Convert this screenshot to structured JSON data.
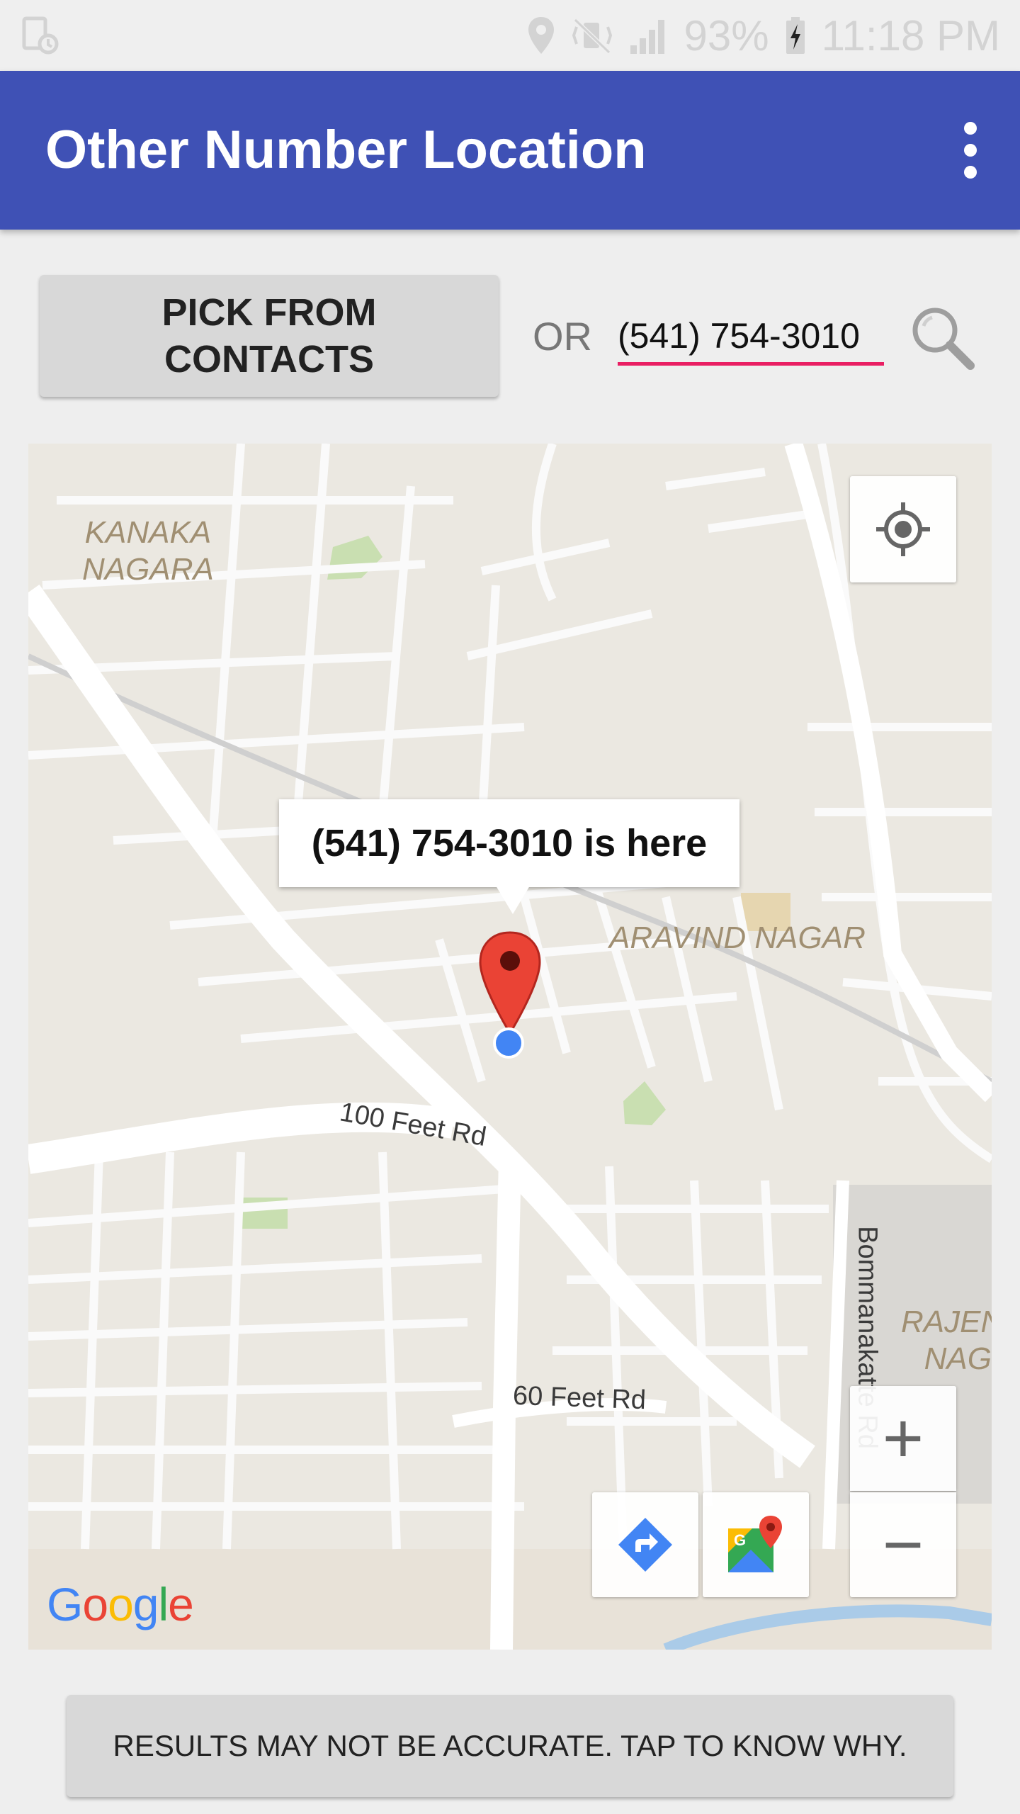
{
  "status_bar": {
    "battery": "93%",
    "time": "11:18 PM",
    "icons": [
      "sim-status-icon",
      "location-icon",
      "vibrate-mute-icon",
      "signal-icon",
      "battery-charging-icon"
    ]
  },
  "app_bar": {
    "title": "Other Number Location",
    "menu_icon": "more-vert-icon"
  },
  "controls": {
    "pick_button_label": "PICK FROM CONTACTS",
    "or_label": "OR",
    "phone_value": "(541) 754-3010",
    "search_icon": "search-icon"
  },
  "map": {
    "info_window_text": "(541) 754-3010 is here",
    "place_labels": {
      "kanaka_line1": "KANAKA",
      "kanaka_line2": "NAGARA",
      "aravind": "ARAVIND NAGAR",
      "rajen_line1": "RAJEN",
      "rajen_line2": "NAG"
    },
    "road_labels": {
      "hundred_feet": "100 Feet Rd",
      "sixty_feet": "60 Feet Rd",
      "bommanakatte": "Bommanakatte Rd"
    },
    "controls": {
      "my_location_icon": "my-location-icon",
      "zoom_in": "+",
      "zoom_out": "−",
      "directions_icon": "directions-icon",
      "maps_icon": "google-maps-icon"
    },
    "logo": {
      "letters": [
        "G",
        "o",
        "o",
        "g",
        "l",
        "e"
      ],
      "colors": [
        "#4285F4",
        "#EA4335",
        "#FBBC05",
        "#4285F4",
        "#34A853",
        "#EA4335"
      ]
    },
    "marker_color": "#EA4335",
    "dot_color": "#4285F4"
  },
  "footer": {
    "accuracy_button_label": "RESULTS MAY NOT BE ACCURATE. TAP TO KNOW WHY."
  },
  "colors": {
    "app_bar": "#3F51B5",
    "input_underline": "#E91E63",
    "button_bg": "#D8D8D8"
  }
}
